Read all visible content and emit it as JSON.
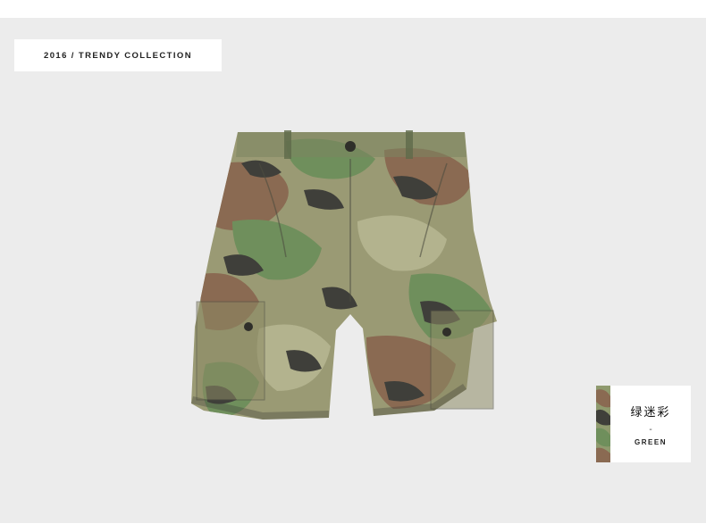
{
  "header": {
    "collection_label": "2016 / TRENDY COLLECTION"
  },
  "product": {
    "image_name": "camo-cargo-shorts",
    "colors": {
      "base": "#8f9a6e",
      "light": "#b3b38e",
      "brown": "#8a6a52",
      "green": "#6f8f5c",
      "dark": "#3f3f3a"
    }
  },
  "color_card": {
    "name_cn": "绿迷彩",
    "separator": "-",
    "name_en": "GREEN"
  }
}
